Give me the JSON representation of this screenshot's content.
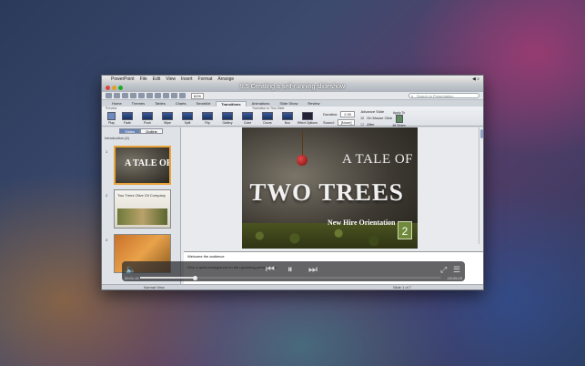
{
  "window": {
    "title": "9.5 Creating a self-running slideshow",
    "menu": [
      "PowerPoint",
      "File",
      "Edit",
      "View",
      "Insert",
      "Format",
      "Arrange"
    ],
    "zoom": "61%",
    "search_placeholder": "Search in Presentation"
  },
  "ribbon": {
    "tabs": [
      "Home",
      "Themes",
      "Tables",
      "Charts",
      "SmartArt",
      "Transitions",
      "Animations",
      "Slide Show",
      "Review"
    ],
    "active_tab": "Transitions",
    "preview_label": "Preview",
    "play_label": "Play",
    "group_label": "Transition to This Slide",
    "transitions": [
      "Fade",
      "Push",
      "Wipe",
      "Split",
      "Flip",
      "Gallery",
      "Cube",
      "Doors",
      "Box"
    ],
    "effect_options_label": "Effect Options",
    "duration_label": "Duration:",
    "duration_value": "2.00",
    "sound_label": "Sound:",
    "sound_value": "[None]",
    "advance_label": "Advance Slide",
    "on_mouse_click": "On Mouse Click",
    "after_label": "After",
    "apply_to_label": "Apply To",
    "all_slides_label": "All Slides"
  },
  "sidebar": {
    "tabs": [
      "Slides",
      "Outline"
    ],
    "section": "Introduction (4)",
    "thumbs": [
      {
        "num": "1",
        "title": "A TALE OF TWO TREES"
      },
      {
        "num": "2",
        "title": "Two Trees Olive Oil Company"
      },
      {
        "num": "3",
        "title": ""
      }
    ]
  },
  "slide": {
    "line1": "A TALE OF",
    "line2": "TWO TREES",
    "subtitle": "New Hire Orientation",
    "badge": "2"
  },
  "notes": {
    "line1": "Welcome the audience",
    "line2": "Give a quick background on the upcoming presentation"
  },
  "status": {
    "view": "Normal View",
    "slide_count": "Slide 1 of 7"
  },
  "player": {
    "elapsed": "00:01:15",
    "remaining": "-00:05:29",
    "progress_fraction": 0.18
  }
}
